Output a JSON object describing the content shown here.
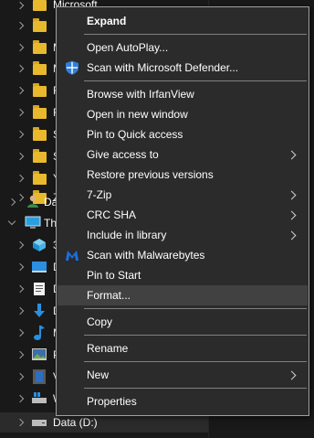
{
  "tree": {
    "top_folder_label": "Microsoft",
    "partial_labels": [
      "M",
      "M",
      "R",
      "R",
      "S",
      "S",
      "Y",
      "Z"
    ],
    "user_item_label": "Da",
    "this_pc_label": "Th",
    "pc_children_labels": [
      "3",
      "D",
      "D",
      "D",
      "M",
      "P",
      "V",
      "W"
    ],
    "drive_label": "Data (D:)"
  },
  "menu": {
    "items": [
      {
        "label": "Expand",
        "bold": true
      },
      {
        "label": "Open AutoPlay..."
      },
      {
        "label": "Scan with Microsoft Defender...",
        "icon": "defender-shield-icon"
      },
      {
        "label": "Browse with IrfanView"
      },
      {
        "label": "Open in new window"
      },
      {
        "label": "Pin to Quick access"
      },
      {
        "label": "Give access to",
        "submenu": true
      },
      {
        "label": "Restore previous versions"
      },
      {
        "label": "7-Zip",
        "submenu": true
      },
      {
        "label": "CRC SHA",
        "submenu": true
      },
      {
        "label": "Include in library",
        "submenu": true
      },
      {
        "label": "Scan with Malwarebytes",
        "icon": "malwarebytes-icon"
      },
      {
        "label": "Pin to Start"
      },
      {
        "label": "Format...",
        "highlighted": true
      },
      {
        "label": "Copy"
      },
      {
        "label": "Rename"
      },
      {
        "label": "New",
        "submenu": true
      },
      {
        "label": "Properties"
      }
    ]
  },
  "colors": {
    "background": "#191919",
    "menu_background": "#2b2b2b",
    "menu_hover": "#414141",
    "folder": "#e8b92d",
    "defender_blue": "#2f7fd8",
    "malwarebytes_blue": "#1b6fe8"
  }
}
